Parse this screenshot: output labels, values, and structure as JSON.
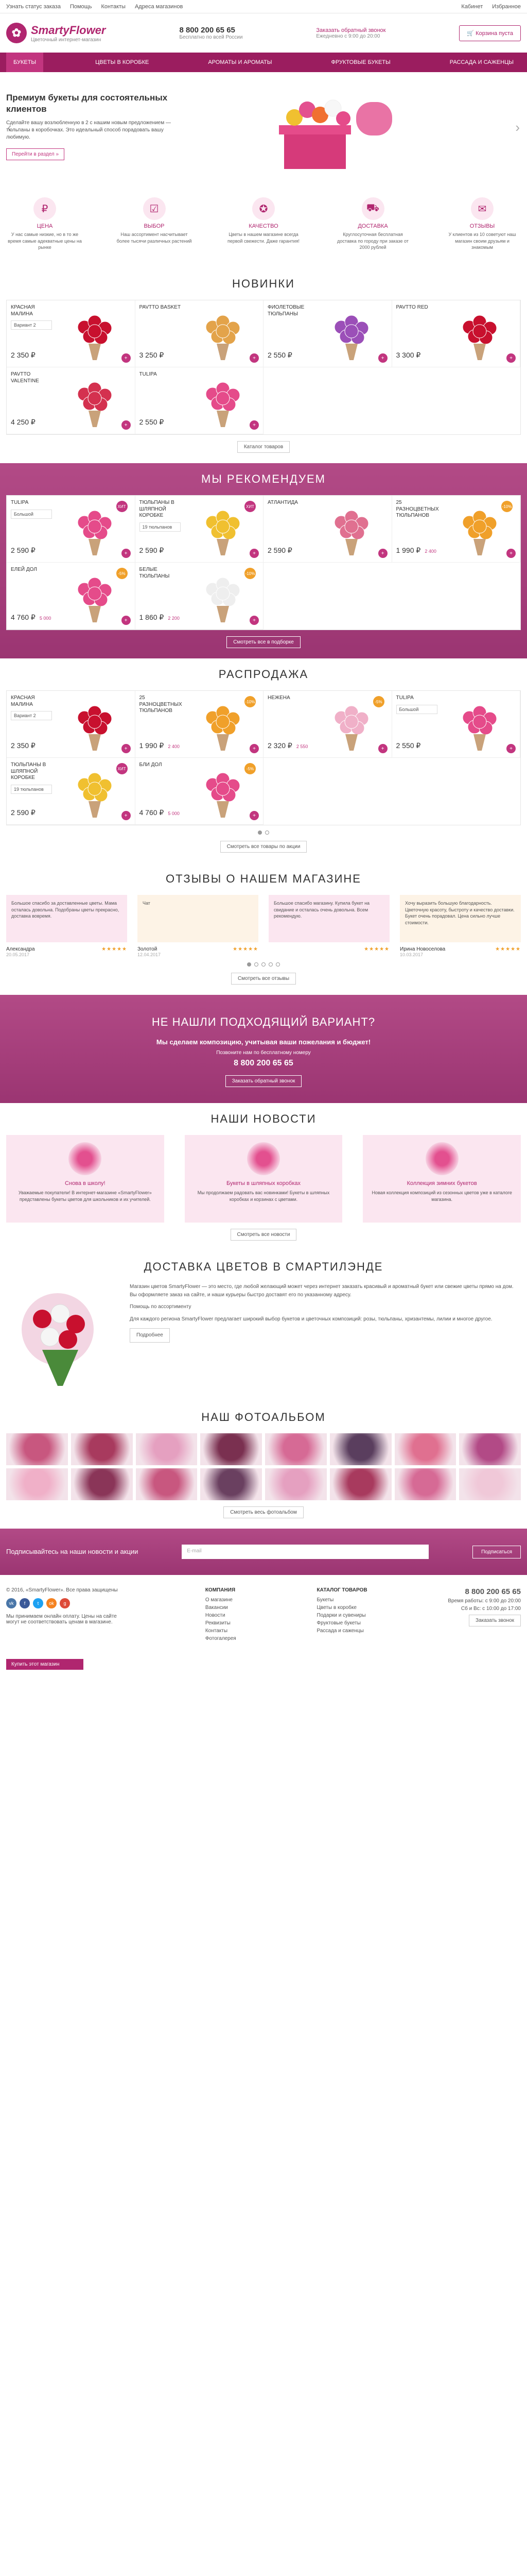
{
  "topbar": {
    "links": [
      "Узнать статус заказа",
      "Помощь",
      "Контакты",
      "Адреса магазинов"
    ],
    "cabinet": "Кабинет",
    "favorites": "Избранное"
  },
  "header": {
    "logo_name": "SmartyFlower",
    "logo_sub": "Цветочный интернет-магазин",
    "phone": "8 800 200 65 65",
    "phone_sub": "Бесплатно по всей России",
    "callback": "Заказать обратный звонок",
    "hours": "Ежедневно с 9:00 до 20:00",
    "cart": "Корзина пуста"
  },
  "nav": [
    "Букеты",
    "Цветы в коробке",
    "Ароматы и ароматы",
    "Фруктовые букеты",
    "Рассада и саженцы"
  ],
  "hero": {
    "title": "Премиум букеты для состоятельных клиентов",
    "desc": "Сделайте вашу возлюбленную в 2 с нашим новым предложением — тюльпаны в коробочках. Это идеальный способ порадовать вашу любимую.",
    "button": "Перейти в раздел »"
  },
  "features": [
    {
      "icon": "piggy-icon",
      "title": "ЦЕНА",
      "text": "У нас самые низкие, но в то же время самые адекватные цены на рынке"
    },
    {
      "icon": "select-icon",
      "title": "ВЫБОР",
      "text": "Наш ассортимент насчитывает более тысячи различных растений"
    },
    {
      "icon": "quality-icon",
      "title": "КАЧЕСТВО",
      "text": "Цветы в нашем магазине всегда первой свежести. Даже гарантия!"
    },
    {
      "icon": "truck-icon",
      "title": "ДОСТАВКА",
      "text": "Круглосуточная бесплатная доставка по городу при заказе от 2000 рублей"
    },
    {
      "icon": "review-icon",
      "title": "ОТЗЫВЫ",
      "text": "У клиентов из 10 советуют наш магазин своим друзьям и знакомым"
    }
  ],
  "sections": {
    "new": {
      "title": "НОВИНКИ",
      "button": "Каталог товаров",
      "items": [
        {
          "name": "КРАСНАЯ МАЛИНА",
          "variant": "Вариант 2",
          "price": "2 350",
          "old": "",
          "badge": "",
          "color": "#c8102e"
        },
        {
          "name": "PAVTTO BASKET",
          "variant": "",
          "price": "3 250",
          "old": "",
          "badge": "",
          "color": "#e3a34a"
        },
        {
          "name": "ФИОЛЕТОВЫЕ ТЮЛЬПАНЫ",
          "variant": "",
          "price": "2 550",
          "old": "",
          "badge": "",
          "color": "#9b4fb8"
        },
        {
          "name": "PAVTTO RED",
          "variant": "",
          "price": "3 300",
          "old": "",
          "badge": "",
          "color": "#c8102e"
        },
        {
          "name": "PAVTTO VALENTINE",
          "variant": "",
          "price": "4 250",
          "old": "",
          "badge": "",
          "color": "#d4314f"
        },
        {
          "name": "TULIPA",
          "variant": "",
          "price": "2 550",
          "old": "",
          "badge": "",
          "color": "#e54b8a"
        }
      ]
    },
    "recommend": {
      "title": "МЫ РЕКОМЕНДУЕМ",
      "button": "Смотреть все в подборке",
      "items": [
        {
          "name": "TULIPA",
          "variant": "Большой",
          "price": "2 590",
          "old": "",
          "badge": "ХИТ",
          "color": "#e54b8a"
        },
        {
          "name": "ТЮЛЬПАНЫ В ШЛЯПНОЙ КОРОБКЕ",
          "variant": "19 тюльпанов",
          "price": "2 590",
          "old": "",
          "badge": "ХИТ",
          "color": "#f0c030"
        },
        {
          "name": "АТЛАНТИДА",
          "variant": "",
          "price": "2 590",
          "old": "",
          "badge": "",
          "color": "#e07090"
        },
        {
          "name": "25 РАЗНОЦВЕТНЫХ ТЮЛЬПАНОВ",
          "variant": "",
          "price": "1 990",
          "old": "2 400",
          "badge": "-10%",
          "color": "#f0a02a"
        },
        {
          "name": "ЕЛЕЙ ДОЛ",
          "variant": "",
          "price": "4 760",
          "old": "5 000",
          "badge": "-5%",
          "color": "#e54b8a"
        },
        {
          "name": "БЕЛЫЕ ТЮЛЬПАНЫ",
          "variant": "",
          "price": "1 860",
          "old": "2 200",
          "badge": "-10%",
          "color": "#eeeeee"
        }
      ]
    },
    "sale": {
      "title": "РАСПРОДАЖА",
      "button": "Смотреть все товары по акции",
      "items": [
        {
          "name": "КРАСНАЯ МАЛИНА",
          "variant": "Вариант 2",
          "price": "2 350",
          "old": "",
          "badge": "",
          "color": "#c8102e"
        },
        {
          "name": "25 РАЗНОЦВЕТНЫХ ТЮЛЬПАНОВ",
          "variant": "",
          "price": "1 990",
          "old": "2 400",
          "badge": "-10%",
          "color": "#f0a02a"
        },
        {
          "name": "НЕЖЕНА",
          "variant": "",
          "price": "2 320",
          "old": "2 550",
          "badge": "-5%",
          "color": "#f0b0c8"
        },
        {
          "name": "TULIPA",
          "variant": "Большой",
          "price": "2 550",
          "old": "",
          "badge": "",
          "color": "#e54b8a"
        },
        {
          "name": "ТЮЛЬПАНЫ В ШЛЯПНОЙ КОРОБКЕ",
          "variant": "19 тюльпанов",
          "price": "2 590",
          "old": "",
          "badge": "ХИТ",
          "color": "#f0c030"
        },
        {
          "name": "БЛИ ДОЛ",
          "variant": "",
          "price": "4 760",
          "old": "5 000",
          "badge": "-5%",
          "color": "#e54b8a"
        }
      ]
    }
  },
  "reviews": {
    "title": "ОТЗЫВЫ О НАШЕМ МАГАЗИНЕ",
    "button": "Смотреть все отзывы",
    "items": [
      {
        "text": "Большое спасибо за доставленные цветы. Мама осталась довольна. Подобраны цветы прекрасно, доставка вовремя.",
        "author": "Александра",
        "date": "20.05.2017"
      },
      {
        "text": "Чат",
        "author": "Золотой",
        "date": "12.04.2017"
      },
      {
        "text": "Большое спасибо магазину. Купила букет на свидание и осталась очень довольна. Всем рекомендую.",
        "author": "",
        "date": ""
      },
      {
        "text": "Хочу выразить большую благодарность. Цветочную красоту, быстроту и качество доставки. Букет очень порадовал. Цена сильно лучше стоимости.",
        "author": "Ирина Новоселова",
        "date": "10.03.2017"
      }
    ]
  },
  "promo": {
    "title": "НЕ НАШЛИ ПОДХОДЯЩИЙ ВАРИАНТ?",
    "sub": "Мы сделаем композицию, учитывая ваши пожелания и бюджет!",
    "text": "Позвоните нам по бесплатному номеру",
    "phone": "8 800 200 65 65",
    "button": "Заказать обратный звонок"
  },
  "news": {
    "title": "НАШИ НОВОСТИ",
    "button": "Смотреть все новости",
    "items": [
      {
        "title": "Снова в школу!",
        "text": "Уважаемые покупатели! В интернет-магазине «SmartyFlower» представлены букеты цветов для школьников и их учителей."
      },
      {
        "title": "Букеты в шляпных коробках",
        "text": "Мы продолжаем радовать вас новинками! Букеты в шляпных коробках и корзинах с цветами."
      },
      {
        "title": "Коллекция зимних букетов",
        "text": "Новая коллекция композиций из сезонных цветов уже в каталоге магазина."
      }
    ]
  },
  "delivery": {
    "title": "ДОСТАВКА ЦВЕТОВ В СМАРТИЛЭНДЕ",
    "paragraphs": [
      "Магазин цветов SmartyFlower — это место, где любой желающий может через интернет заказать красивый и ароматный букет или свежие цветы прямо на дом. Вы оформляете заказ на сайте, и наши курьеры быстро доставят его по указанному адресу.",
      "Помощь по ассортименту",
      "Для каждого региона SmartyFlower предлагает широкий выбор букетов и цветочных композиций: розы, тюльпаны, хризантемы, лилии и многое другое."
    ],
    "button": "Подробнее"
  },
  "photos": {
    "title": "НАШ ФОТОАЛЬБОМ",
    "button": "Смотреть весь фотоальбом",
    "colors": [
      "#c8577f",
      "#a83a5e",
      "#e5a0c0",
      "#7a3050",
      "#d66a95",
      "#5a3e5e",
      "#e07090",
      "#b24a86",
      "#f0b0c8",
      "#8a3558",
      "#c8577f",
      "#6a4060",
      "#e5a0c0",
      "#a83a5e",
      "#d66a95",
      "#f0c8d8"
    ]
  },
  "subscribe": {
    "title": "Подписывайтесь на наши новости и акции",
    "placeholder": "E-mail",
    "button": "Подписаться"
  },
  "footer": {
    "copyright": "© 2016, «SmartyFlower». Все права защищены",
    "desc": "Мы принимаем онлайн оплату. Цены на сайте могут не соответствовать ценам в магазине.",
    "buy": "Купить этот магазин",
    "col1": {
      "title": "КОМПАНИЯ",
      "items": [
        "О магазине",
        "Вакансии",
        "Новости",
        "Реквизиты",
        "Контакты",
        "Фотогалерея"
      ]
    },
    "col2": {
      "title": "КАТАЛОГ ТОВАРОВ",
      "items": [
        "Букеты",
        "Цветы в коробке",
        "Подарки и сувениры",
        "Фруктовые букеты",
        "Рассада и саженцы"
      ]
    },
    "contact": {
      "phone": "8 800 200 65 65",
      "hours1": "Время работы: с 9:00 до 20:00",
      "hours2": "Сб и Вс: с 10:00 до 17:00",
      "callback": "Заказать звонок"
    }
  }
}
